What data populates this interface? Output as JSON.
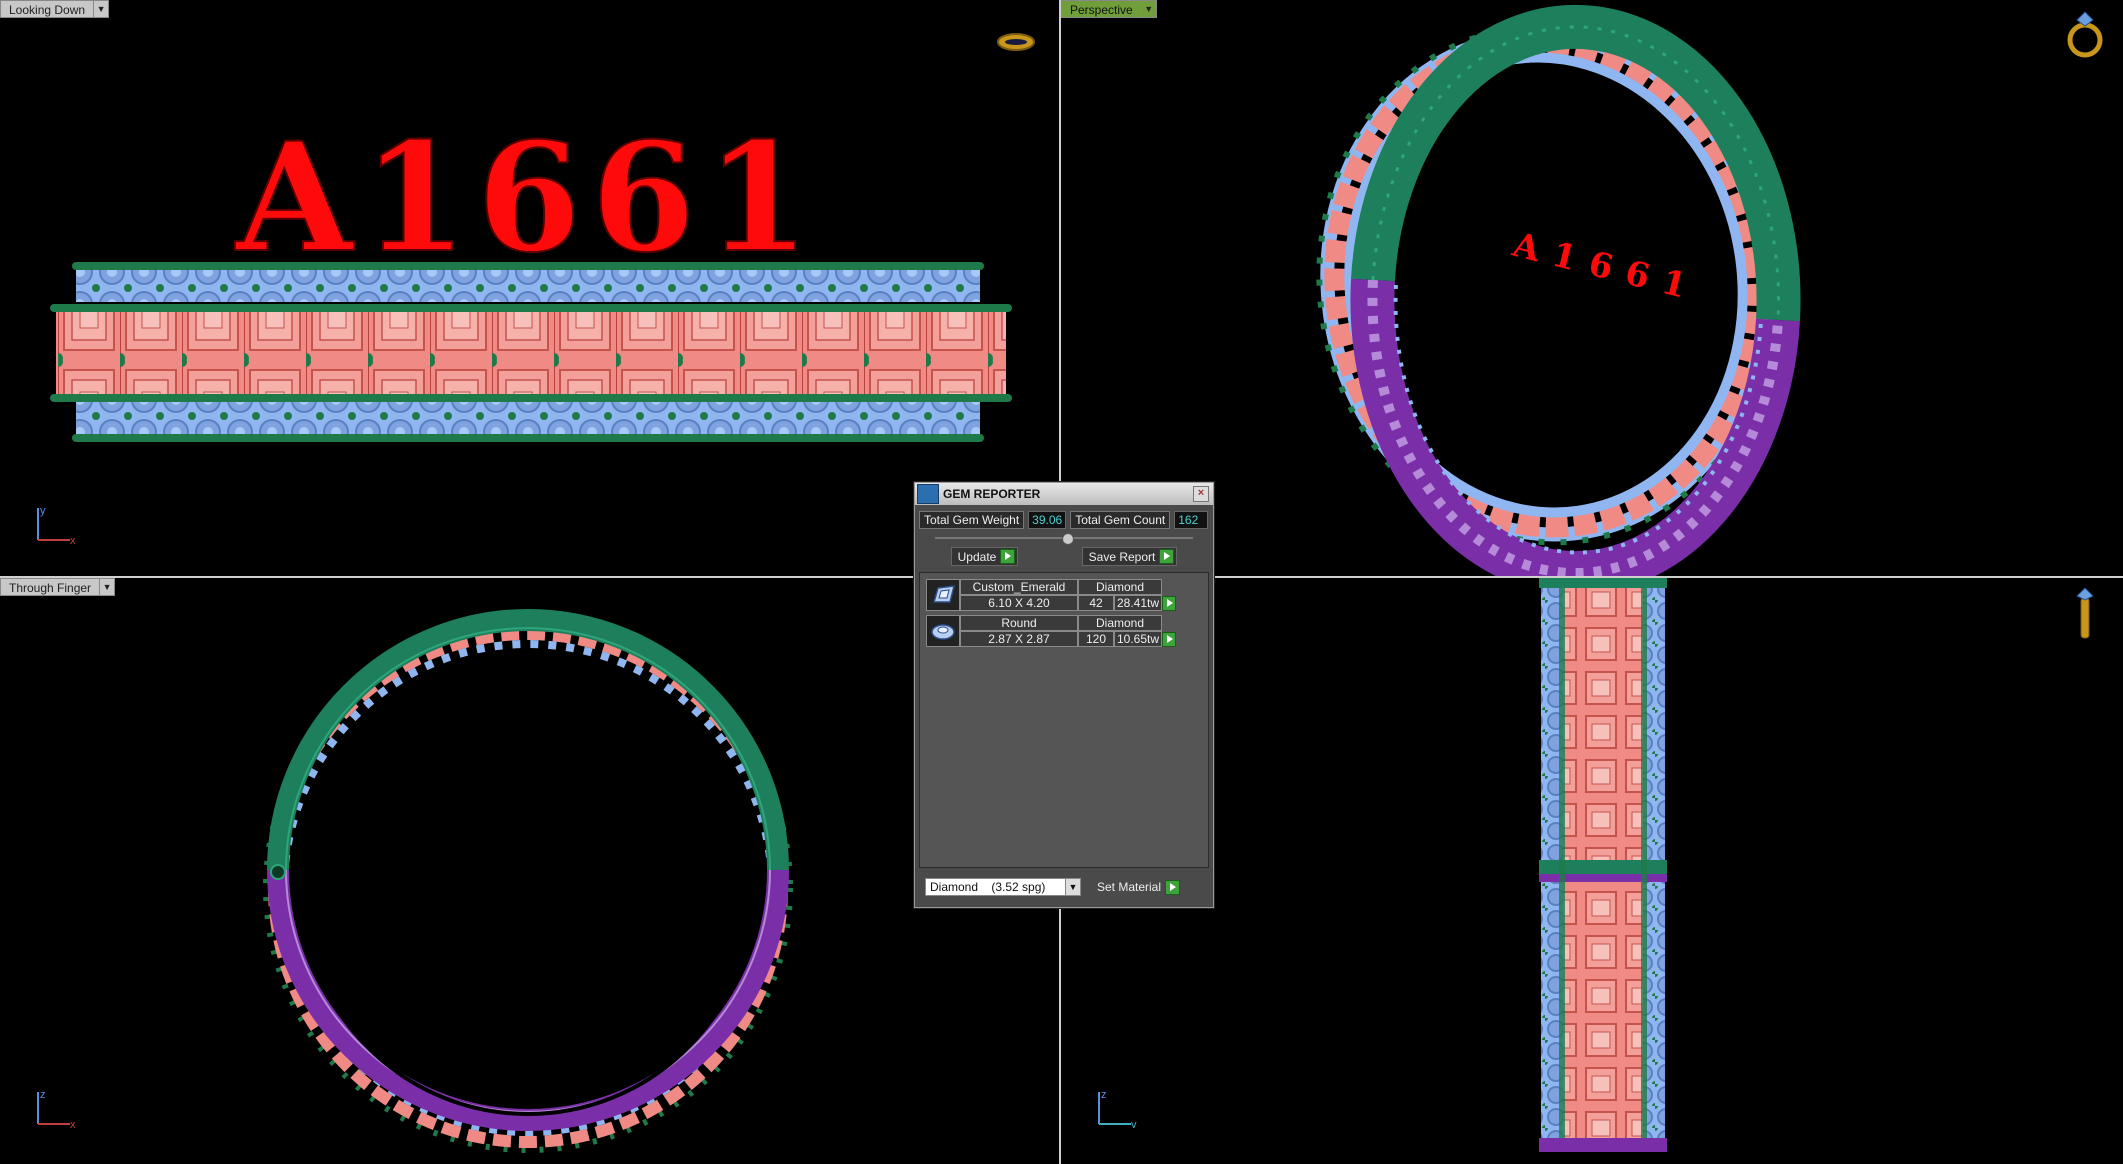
{
  "viewports": {
    "top_left": {
      "label": "Looking Down",
      "axis_v": "y",
      "axis_h": "x",
      "engraving": "A1661"
    },
    "top_right": {
      "label": "Perspective",
      "engraving": "A1661"
    },
    "bottom_left": {
      "label": "Through Finger",
      "axis_v": "z",
      "axis_h": "x"
    },
    "bottom_right": {
      "axis_v": "z",
      "axis_h": "y"
    }
  },
  "gem_reporter": {
    "title": "GEM REPORTER",
    "total_weight_label": "Total Gem Weight",
    "total_weight_value": "39.06",
    "total_count_label": "Total Gem Count",
    "total_count_value": "162",
    "update_label": "Update",
    "save_report_label": "Save Report",
    "gems": [
      {
        "name": "Custom_Emerald",
        "material": "Diamond",
        "size": "6.10 X 4.20",
        "count": "42",
        "weight": "28.41tw",
        "icon": "emerald-cut-icon"
      },
      {
        "name": "Round",
        "material": "Diamond",
        "size": "2.87 X 2.87",
        "count": "120",
        "weight": "10.65tw",
        "icon": "round-cut-icon"
      }
    ],
    "material_select": "Diamond    (3.52 spg)",
    "set_material_label": "Set Material"
  },
  "colors": {
    "background": "#000000",
    "emerald_stones": "#f08a84",
    "round_stones": "#8fb6f0",
    "prongs": "#1f7a4a",
    "band_green": "#1d7f5c",
    "band_purple": "#7a2fa8",
    "engraving": "#ff0a0a",
    "active_label": "#6f9e3b"
  }
}
